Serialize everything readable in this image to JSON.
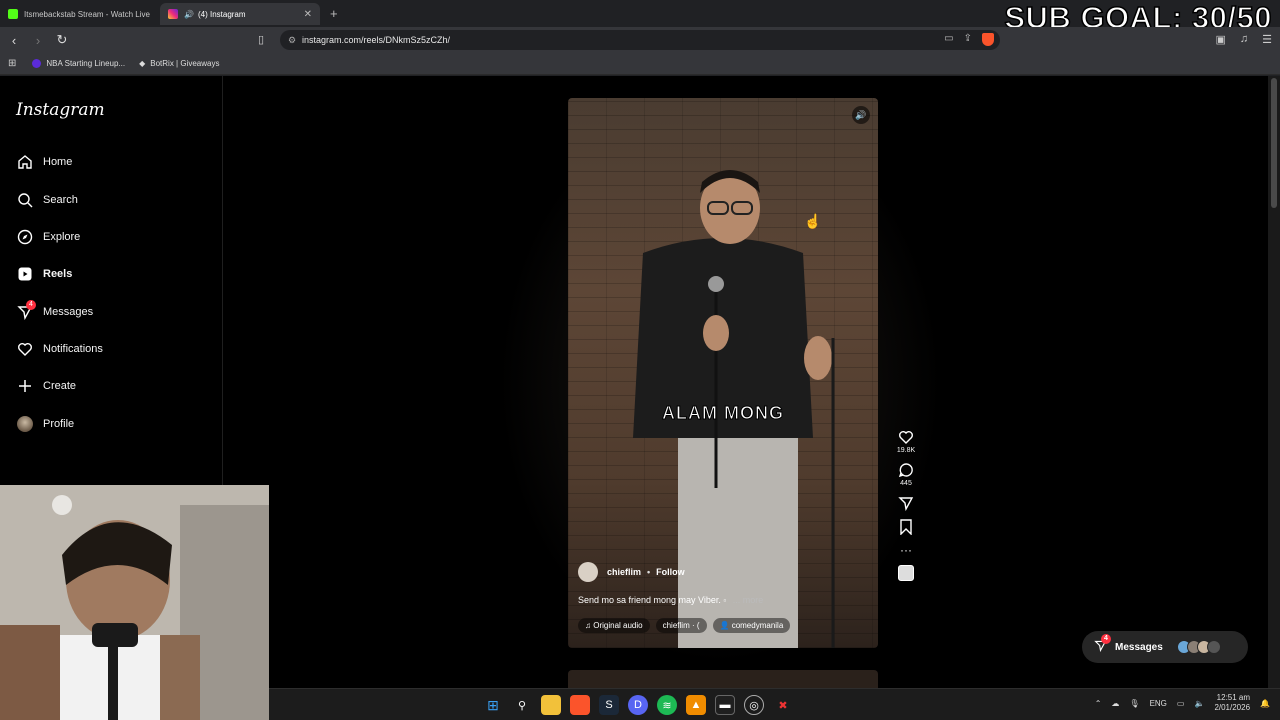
{
  "browser": {
    "tabs": [
      {
        "label": "Itsmebackstab Stream - Watch Live o",
        "icon": "kick-icon",
        "color": "#53fc18"
      },
      {
        "label": "(4) Instagram",
        "icon": "instagram-icon",
        "color": "#e1306c"
      }
    ],
    "url": "instagram.com/reels/DNkmSz5zCZh/",
    "bookmarks": [
      {
        "label": "NBA Starting Lineup...",
        "color": "#5b2bd8"
      },
      {
        "label": "BotRix | Giveaways",
        "color": "#dddddd"
      }
    ]
  },
  "overlay": {
    "sub_goal": "SUB GOAL: 30/50"
  },
  "instagram": {
    "logo": "Instagram",
    "nav": [
      {
        "label": "Home",
        "icon": "home-icon"
      },
      {
        "label": "Search",
        "icon": "search-icon"
      },
      {
        "label": "Explore",
        "icon": "compass-icon"
      },
      {
        "label": "Reels",
        "icon": "reels-icon"
      },
      {
        "label": "Messages",
        "icon": "messenger-icon",
        "badge": "4"
      },
      {
        "label": "Notifications",
        "icon": "heart-icon"
      },
      {
        "label": "Create",
        "icon": "plus-icon"
      },
      {
        "label": "Profile",
        "icon": "avatar-icon"
      }
    ],
    "reel": {
      "caption_overlay": "ALAM MONG",
      "author": "chieflim",
      "follow": "Follow",
      "description": "Send mo sa friend mong may Viber. ",
      "more": "... more",
      "audio": "Original audio",
      "audio_author": "chieflim · (",
      "tagged": "comedymanila"
    },
    "actions": {
      "likes": "19.8K",
      "comments": "445"
    },
    "messages_pill": {
      "label": "Messages",
      "badge": "4"
    }
  },
  "taskbar": {
    "lang": "ENG",
    "time": "12:51 am",
    "date": "2/01/2026"
  }
}
